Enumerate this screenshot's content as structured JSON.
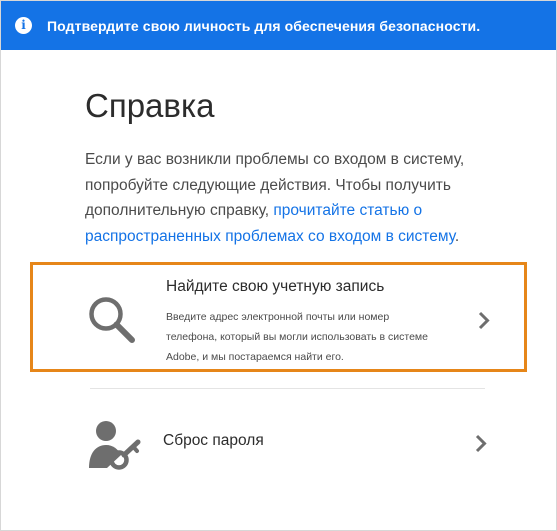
{
  "banner": {
    "icon": "info-icon",
    "text": "Подтвердите свою личность для обеспечения безопасности."
  },
  "page": {
    "title": "Справка",
    "description_prefix": "Если у вас возникли проблемы со входом в систему, попробуйте следующие действия. Чтобы получить дополнительную справку, ",
    "description_link": "прочитайте статью о распространенных проблемах со входом в систему",
    "description_suffix": "."
  },
  "options": [
    {
      "icon": "search-icon",
      "title": "Найдите свою учетную запись",
      "description": "Введите адрес электронной почты или номер телефона, который вы могли использовать в системе Adobe, и мы постараемся найти его.",
      "chevron": "chevron-right-icon",
      "highlighted": true
    },
    {
      "icon": "user-key-icon",
      "title": "Сброс пароля",
      "chevron": "chevron-right-icon",
      "highlighted": false
    }
  ],
  "colors": {
    "banner": "#1473e6",
    "link": "#1473e6",
    "highlight_border": "#e68619",
    "icon_gray": "#6e6e6e"
  }
}
